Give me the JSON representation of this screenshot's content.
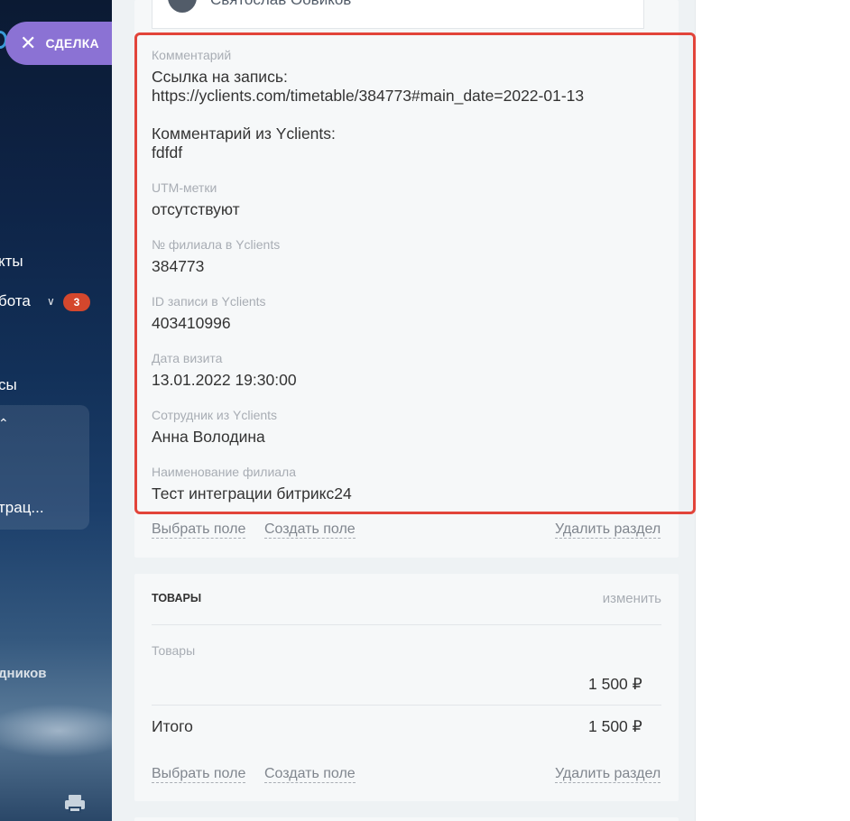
{
  "sidebar": {
    "deal_label": "СДЕЛКА",
    "items": [
      {
        "label": "кты"
      },
      {
        "label": "бота",
        "badge": "3"
      },
      {
        "label": "сы"
      },
      {
        "label": "трац..."
      },
      {
        "label": "дников"
      }
    ]
  },
  "top_contact": {
    "name": "Святослав Оовиков"
  },
  "fields": [
    {
      "label": "Комментарий",
      "value": "Ссылка на запись:\nhttps://yclients.com/timetable/384773#main_date=2022-01-13\n\nКомментарий из Yclients:\nfdfdf"
    },
    {
      "label": "UTM-метки",
      "value": "отсутствуют"
    },
    {
      "label": "№ филиала в Yclients",
      "value": "384773"
    },
    {
      "label": "ID записи в Yclients",
      "value": "403410996"
    },
    {
      "label": "Дата визита",
      "value": "13.01.2022 19:30:00"
    },
    {
      "label": "Сотрудник из Yclients",
      "value": "Анна Володина"
    },
    {
      "label": "Наименование филиала",
      "value": "Тест интеграции битрикс24"
    }
  ],
  "section_actions": {
    "select_field": "Выбрать поле",
    "create_field": "Создать поле",
    "delete_section": "Удалить раздел"
  },
  "products": {
    "header": "ТОВАРЫ",
    "change": "изменить",
    "label": "Товары",
    "amount": "1 500 ₽",
    "total_label": "Итого",
    "total_amount": "1 500 ₽"
  },
  "colors": {
    "deal_pill": "#8b72d4",
    "highlight": "#e2443a",
    "badge": "#d4472d"
  }
}
